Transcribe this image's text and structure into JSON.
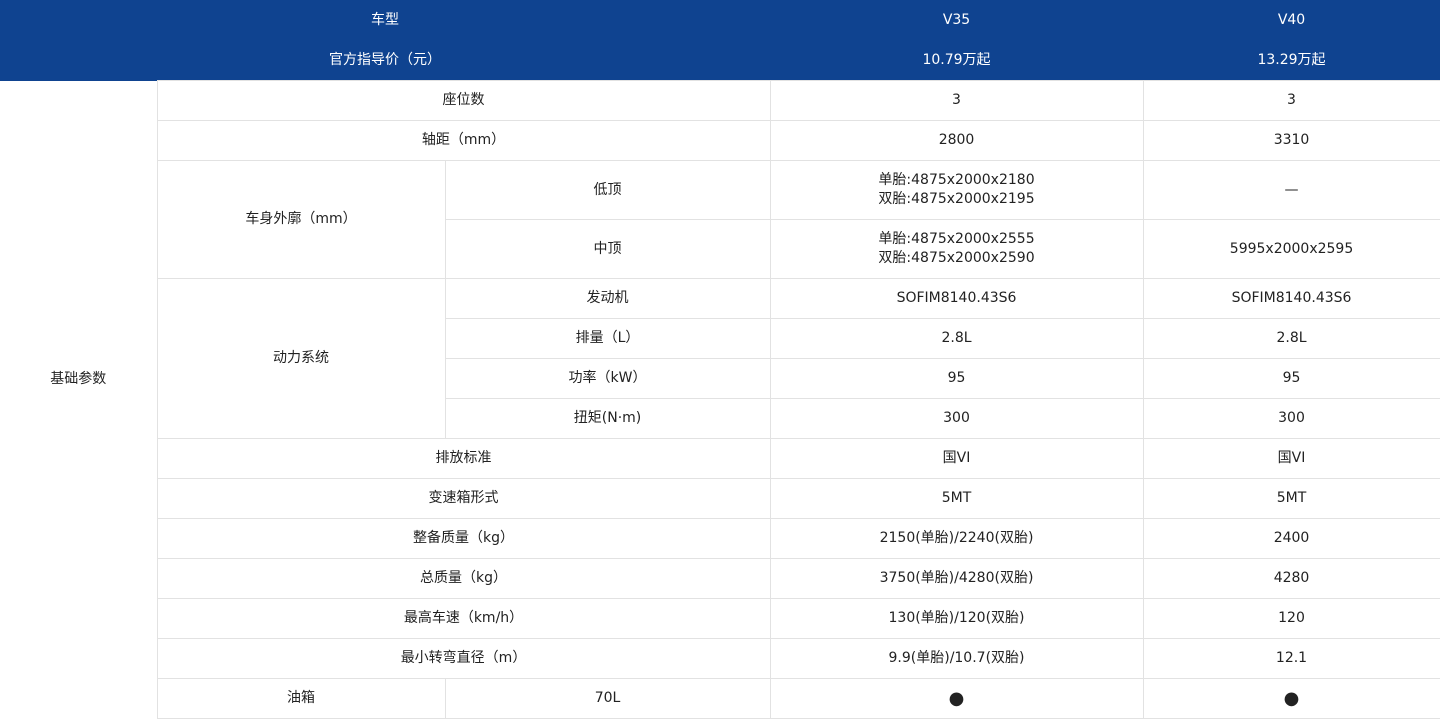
{
  "header": {
    "model_label": "车型",
    "models": [
      "V35",
      "V40"
    ],
    "price_label": "官方指导价（元）",
    "prices": [
      "10.79万起",
      "13.29万起"
    ]
  },
  "section": {
    "label": "基础参数"
  },
  "rows": {
    "seats": {
      "label": "座位数",
      "v35": "3",
      "v40": "3"
    },
    "wheelbase": {
      "label": "轴距（mm）",
      "v35": "2800",
      "v40": "3310"
    },
    "body": {
      "label": "车身外廓（mm）",
      "low": {
        "label": "低顶",
        "v35_line1": "单胎:4875x2000x2180",
        "v35_line2": "双胎:4875x2000x2195",
        "v40": "—"
      },
      "mid": {
        "label": "中顶",
        "v35_line1": "单胎:4875x2000x2555",
        "v35_line2": "双胎:4875x2000x2590",
        "v40": "5995x2000x2595"
      }
    },
    "power": {
      "label": "动力系统",
      "engine": {
        "label": "发动机",
        "v35": "SOFIM8140.43S6",
        "v40": "SOFIM8140.43S6"
      },
      "displacement": {
        "label": "排量（L）",
        "v35": "2.8L",
        "v40": "2.8L"
      },
      "power_kw": {
        "label": "功率（kW）",
        "v35": "95",
        "v40": "95"
      },
      "torque": {
        "label": "扭矩(N·m)",
        "v35": "300",
        "v40": "300"
      }
    },
    "emission": {
      "label": "排放标准",
      "v35": "国VI",
      "v40": "国VI"
    },
    "transmission": {
      "label": "变速箱形式",
      "v35": "5MT",
      "v40": "5MT"
    },
    "curb_weight": {
      "label": "整备质量（kg）",
      "v35": "2150(单胎)/2240(双胎)",
      "v40": "2400"
    },
    "gross_weight": {
      "label": "总质量（kg）",
      "v35": "3750(单胎)/4280(双胎)",
      "v40": "4280"
    },
    "top_speed": {
      "label": "最高车速（km/h）",
      "v35": "130(单胎)/120(双胎)",
      "v40": "120"
    },
    "turning": {
      "label": "最小转弯直径（m）",
      "v35": "9.9(单胎)/10.7(双胎)",
      "v40": "12.1"
    },
    "fuel": {
      "label": "油箱",
      "sub": "70L",
      "v35": "●",
      "v40": "●"
    }
  }
}
